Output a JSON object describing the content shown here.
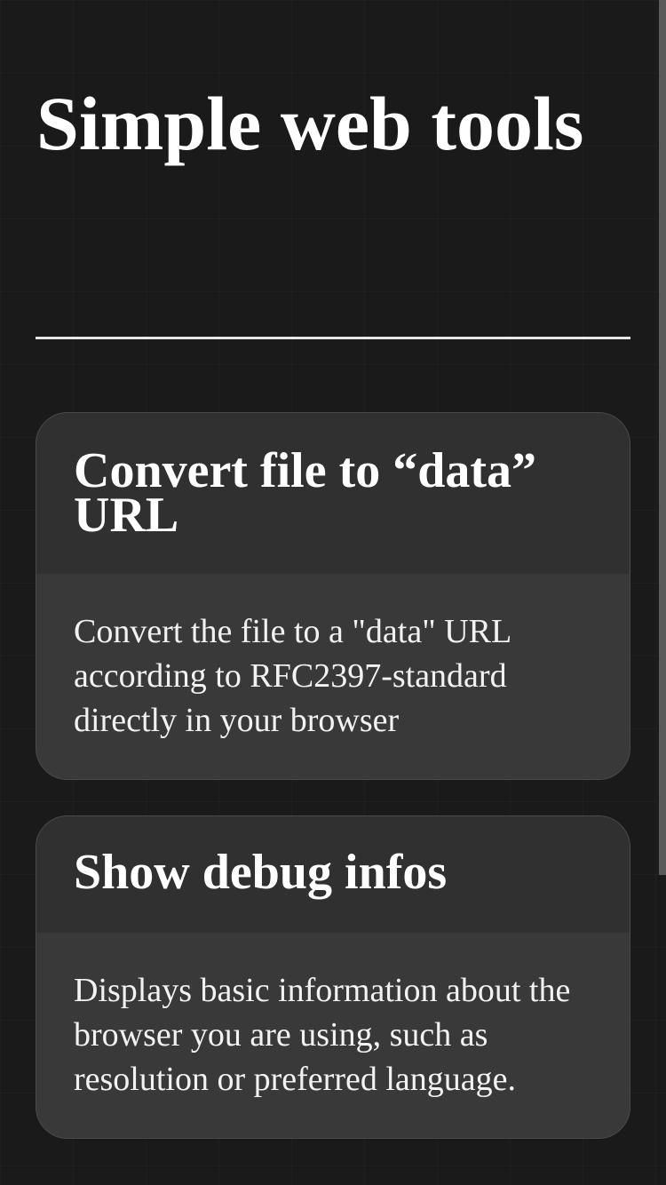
{
  "page": {
    "title": "Simple web tools"
  },
  "tools": [
    {
      "title": "Convert file to “data” URL",
      "description": "Convert the file to a \"data\" URL according to RFC2397-standard directly in your browser"
    },
    {
      "title": "Show debug infos",
      "description": "Displays basic information about the browser you are using, such as resolution or preferred language."
    }
  ],
  "colors": {
    "background": "#1a1a1a",
    "card_header": "#303030",
    "card_body": "#393939",
    "text": "#ffffff"
  }
}
